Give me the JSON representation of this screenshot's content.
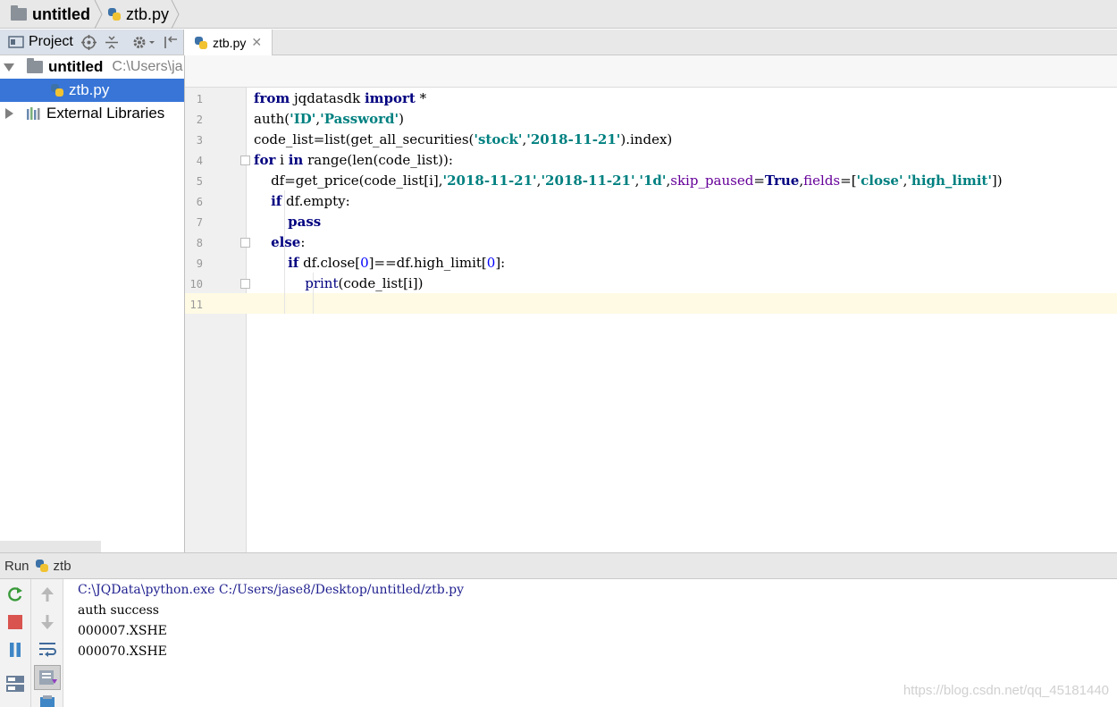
{
  "navbar": {
    "project_name": "untitled",
    "file_name": "ztb.py"
  },
  "project_panel": {
    "header_label": "Project",
    "root_name": "untitled",
    "root_path": "C:\\Users\\ja",
    "file_name": "ztb.py",
    "libraries_label": "External Libraries"
  },
  "editor": {
    "tab_label": "ztb.py",
    "tab_close": "✕",
    "line_numbers": [
      "1",
      "2",
      "3",
      "4",
      "5",
      "6",
      "7",
      "8",
      "9",
      "10",
      "11"
    ]
  },
  "run_panel": {
    "label": "Run",
    "config_name": "ztb",
    "console_lines": [
      "C:\\JQData\\python.exe C:/Users/jase8/Desktop/untitled/ztb.py",
      "auth success",
      "000007.XSHE",
      "000070.XSHE"
    ]
  },
  "watermark": "https://blog.csdn.net/qq_45181440",
  "colors": {
    "keyword": "#000080",
    "string": "#008080",
    "param": "#660099",
    "selection": "#3875d7",
    "caret_line": "#fffae3"
  }
}
